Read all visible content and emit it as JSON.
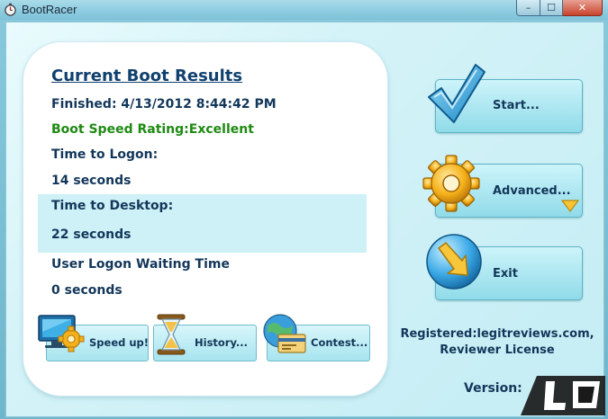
{
  "window": {
    "title": "BootRacer",
    "controls": {
      "minimize": "–",
      "maximize": "☐",
      "close": "✕"
    }
  },
  "results": {
    "heading": "Current Boot Results",
    "finished": "Finished: 4/13/2012 8:44:42 PM",
    "rating": "Boot Speed Rating:Excellent",
    "logon_label": "Time to Logon:",
    "logon_value": "14 seconds",
    "desktop_label": "Time to Desktop:",
    "desktop_value": "22 seconds",
    "waiting_label": "User Logon Waiting Time",
    "waiting_value": "0 seconds"
  },
  "small_buttons": [
    {
      "label": "Speed up!",
      "icon": "monitor-gear-icon"
    },
    {
      "label": "History...",
      "icon": "hourglass-icon"
    },
    {
      "label": "Contest...",
      "icon": "globe-card-icon"
    }
  ],
  "actions": [
    {
      "label": "Start...",
      "icon": "checkmark-icon"
    },
    {
      "label": "Advanced...",
      "icon": "gear-icon"
    },
    {
      "label": "Exit",
      "icon": "exit-arrow-icon"
    }
  ],
  "registration": {
    "line1": "Registered:legitreviews.com,",
    "line2": "Reviewer License"
  },
  "version_label": "Version:",
  "colors": {
    "accent": "#13375a",
    "rating_green": "#1e8a12",
    "panel_bg": "#c4edf4"
  }
}
